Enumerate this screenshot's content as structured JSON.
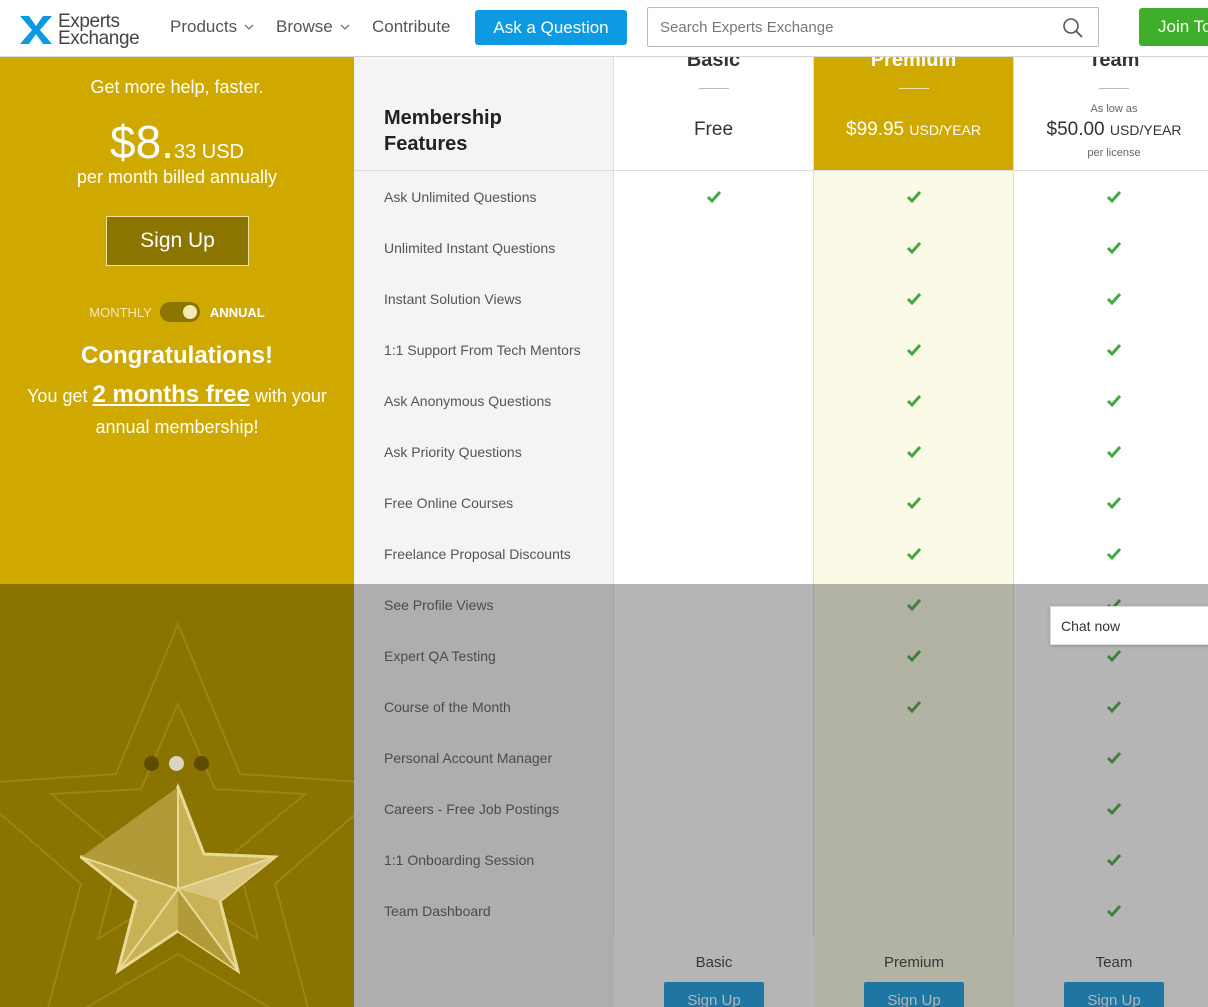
{
  "header": {
    "logo_line1": "Experts",
    "logo_line2": "Exchange",
    "nav": {
      "products": "Products",
      "browse": "Browse",
      "contribute": "Contribute"
    },
    "ask_label": "Ask a Question",
    "search_placeholder": "Search Experts Exchange",
    "join_label": "Join To"
  },
  "promo": {
    "tagline": "Get more help, faster.",
    "price_main": "$8.",
    "price_cents": "33 USD",
    "billing": "per month billed annually",
    "signup_label": "Sign Up",
    "toggle_monthly": "MONTHLY",
    "toggle_annual": "ANNUAL",
    "toggle_state": "annual",
    "congrats": "Congratulations!",
    "free_prefix": "You get",
    "free_highlight": "2 months free",
    "free_suffix": "with your annual membership!",
    "carousel_active": 2
  },
  "table": {
    "feature_header": "Membership Features",
    "plans": {
      "basic": {
        "name": "Basic",
        "price": "Free"
      },
      "premium": {
        "name": "Premium",
        "price": "$99.95",
        "unit": "USD/YEAR"
      },
      "team": {
        "name": "Team",
        "as_low": "As low as",
        "price": "$50.00",
        "unit": "USD/YEAR",
        "per": "per license"
      }
    },
    "features": [
      {
        "name": "Ask Unlimited Questions",
        "basic": true,
        "premium": true,
        "team": true
      },
      {
        "name": "Unlimited Instant Questions",
        "basic": false,
        "premium": true,
        "team": true
      },
      {
        "name": "Instant Solution Views",
        "basic": false,
        "premium": true,
        "team": true
      },
      {
        "name": "1:1 Support From Tech Mentors",
        "basic": false,
        "premium": true,
        "team": true
      },
      {
        "name": "Ask Anonymous Questions",
        "basic": false,
        "premium": true,
        "team": true
      },
      {
        "name": "Ask Priority Questions",
        "basic": false,
        "premium": true,
        "team": true
      },
      {
        "name": "Free Online Courses",
        "basic": false,
        "premium": true,
        "team": true
      },
      {
        "name": "Freelance Proposal Discounts",
        "basic": false,
        "premium": true,
        "team": true
      },
      {
        "name": "See Profile Views",
        "basic": false,
        "premium": true,
        "team": true
      },
      {
        "name": "Expert QA Testing",
        "basic": false,
        "premium": true,
        "team": true
      },
      {
        "name": "Course of the Month",
        "basic": false,
        "premium": true,
        "team": true
      },
      {
        "name": "Personal Account Manager",
        "basic": false,
        "premium": false,
        "team": true
      },
      {
        "name": "Careers - Free Job Postings",
        "basic": false,
        "premium": false,
        "team": true
      },
      {
        "name": "1:1 Onboarding Session",
        "basic": false,
        "premium": false,
        "team": true
      },
      {
        "name": "Team Dashboard",
        "basic": false,
        "premium": false,
        "team": true
      }
    ],
    "footer": {
      "basic": "Basic",
      "premium": "Premium",
      "team": "Team",
      "signup_label": "Sign Up"
    }
  },
  "chat_label": "Chat now",
  "colors": {
    "gold": "#cfa800",
    "dark_gold": "#8a7300",
    "blue": "#0e9ae3",
    "green": "#3fae2a",
    "check": "#43a840"
  }
}
